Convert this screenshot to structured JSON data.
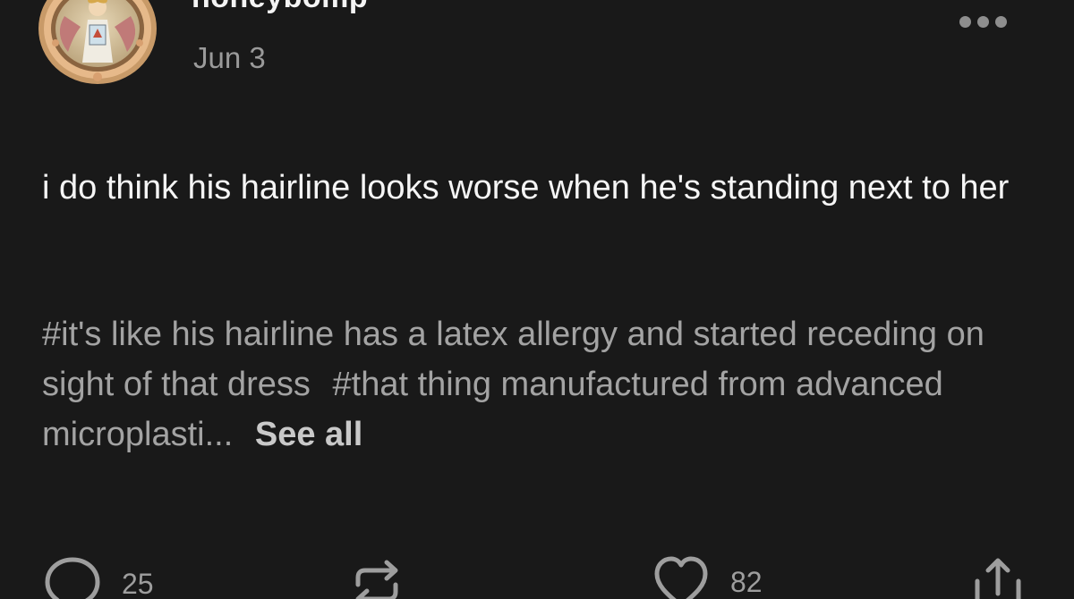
{
  "post": {
    "username": "honeybomp",
    "date": "Jun 3",
    "body": "i do think his hairline looks worse when he's standing next to her",
    "tags": [
      "#it's like his hairline has a latex allergy and started receding on sight of that dress",
      "#that thing manufactured from advanced microplasti..."
    ],
    "see_all": "See all"
  },
  "actions": {
    "replies_count": "25",
    "likes_count": "82"
  },
  "icons": {
    "more": "more-horizontal-icon",
    "reply": "speech-bubble-icon",
    "reblog": "reblog-arrows-icon",
    "like": "heart-icon",
    "share": "share-upload-icon"
  },
  "colors": {
    "background": "#191919",
    "text": "#f5f5f5",
    "muted": "#9a9a9a"
  }
}
